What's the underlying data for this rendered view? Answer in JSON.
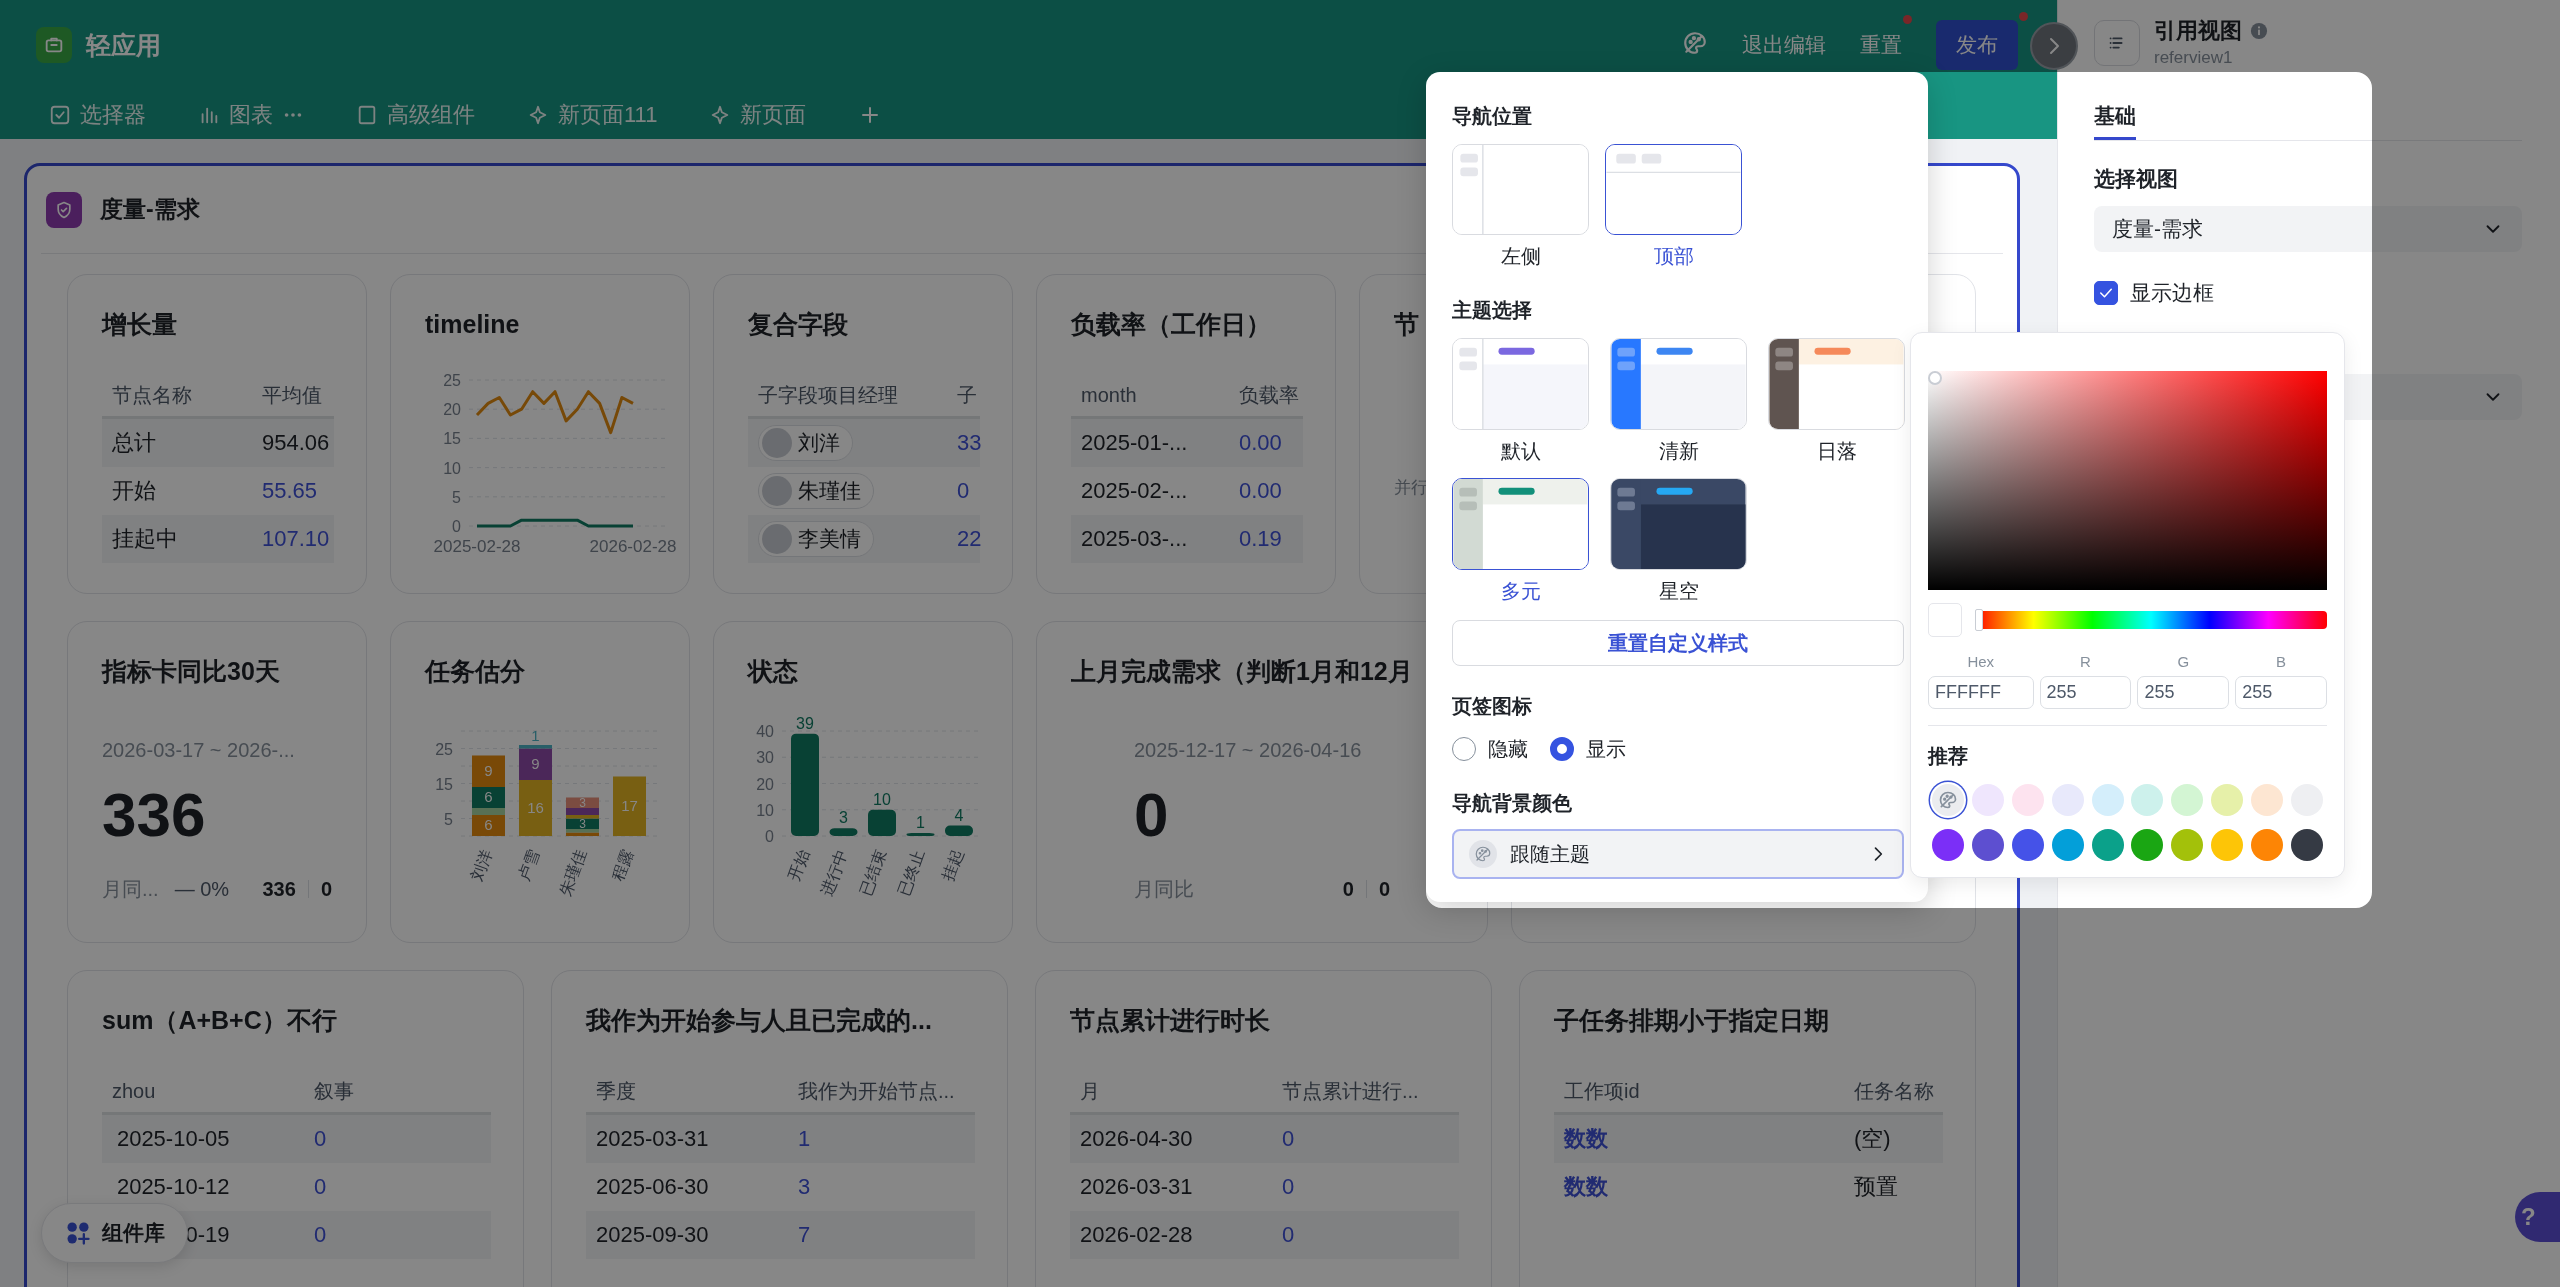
{
  "topbar": {
    "app_name": "轻应用",
    "tabs": [
      {
        "label": "选择器",
        "menu": false,
        "selected": false
      },
      {
        "label": "图表",
        "menu": true,
        "selected": false
      },
      {
        "label": "高级组件",
        "menu": false,
        "selected": false
      },
      {
        "label": "新页面111",
        "menu": false,
        "selected": false
      },
      {
        "label": "新页面",
        "menu": false,
        "selected": false
      }
    ],
    "actions": [
      {
        "label": "退出编辑",
        "kind": "text",
        "dot": false
      },
      {
        "label": "重置",
        "kind": "text",
        "dot": true
      },
      {
        "label": "发布",
        "kind": "primary",
        "dot": true
      }
    ]
  },
  "dashboard": {
    "title": "度量-需求",
    "top_row": [
      {
        "kind": "table",
        "title": "增长量",
        "columns": [
          "节点名称",
          "平均值"
        ],
        "rows": [
          [
            {
              "kind": "text",
              "text": "总计"
            },
            {
              "kind": "text",
              "text": "954.06"
            }
          ],
          [
            {
              "kind": "text",
              "text": "开始"
            },
            {
              "kind": "link",
              "text": "55.65"
            }
          ],
          [
            {
              "kind": "text",
              "text": "挂起中"
            },
            {
              "kind": "link",
              "text": "107.10"
            }
          ]
        ]
      },
      {
        "kind": "chart",
        "title": "timeline",
        "chart_data": {
          "type": "line",
          "grid": true,
          "categories": [
            "2025-02-28",
            null,
            null,
            null,
            null,
            null,
            null,
            null,
            null,
            null,
            null,
            null,
            null,
            null,
            "2026-02-28"
          ],
          "ylim": [
            0,
            25
          ],
          "yticks": [
            0,
            5,
            10,
            15,
            20,
            25
          ],
          "series": [
            {
              "color": "#774908",
              "values": [
                19,
                21,
                22,
                19,
                20,
                23,
                21,
                23,
                18,
                20,
                23,
                21,
                16,
                22,
                21
              ]
            },
            {
              "color": "#084134",
              "values": [
                0,
                0,
                0,
                0,
                1,
                1,
                1,
                1,
                1,
                1,
                0,
                0,
                0,
                0,
                0
              ]
            }
          ]
        }
      },
      {
        "kind": "table",
        "title": "复合字段",
        "columns": [
          "子字段项目经理",
          "子"
        ],
        "rows": [
          [
            {
              "kind": "person",
              "text": "刘洋"
            },
            {
              "kind": "link",
              "text": "33"
            }
          ],
          [
            {
              "kind": "person",
              "text": "朱瑾佳"
            },
            {
              "kind": "link",
              "text": "0"
            }
          ],
          [
            {
              "kind": "person",
              "text": "李美情"
            },
            {
              "kind": "link",
              "text": "22"
            }
          ]
        ]
      },
      {
        "kind": "table",
        "title": "负载率（工作日）",
        "columns": [
          "month",
          "负载率"
        ],
        "rows": [
          [
            {
              "kind": "text",
              "text": "2025-01-..."
            },
            {
              "kind": "link",
              "text": "0.00"
            }
          ],
          [
            {
              "kind": "text",
              "text": "2025-02-..."
            },
            {
              "kind": "link",
              "text": "0.00"
            }
          ],
          [
            {
              "kind": "text",
              "text": "2025-03-..."
            },
            {
              "kind": "link",
              "text": "0.19"
            }
          ]
        ]
      },
      {
        "kind": "note",
        "title": "节",
        "text": "并行"
      }
    ],
    "middle_row": [
      {
        "kind": "metric",
        "title": "指标卡同比30天",
        "date": "2026-03-17 ~ 2026-...",
        "value": "336",
        "compare_label": "月同...",
        "trend": "— 0%",
        "current": "336",
        "previous": "0"
      },
      {
        "kind": "chart",
        "title": "任务估分",
        "chart_data": {
          "type": "bar",
          "stacked": true,
          "grid": true,
          "categories": [
            "刘洋",
            "卢雪",
            "朱瑾佳",
            "程露"
          ],
          "ylim": [
            0,
            30
          ],
          "yticks": [
            5,
            15,
            25
          ],
          "series": [
            {
              "color": "#794907",
              "values": [
                6,
                null,
                1,
                null
              ],
              "value_labels": [
                "6",
                null,
                null,
                null
              ]
            },
            {
              "color": "#587055",
              "values": [
                2,
                null,
                1,
                null
              ],
              "value_labels": [
                null,
                null,
                null,
                null
              ]
            },
            {
              "color": "#084134",
              "values": [
                6,
                null,
                3,
                null
              ],
              "value_labels": [
                "6",
                null,
                "3",
                null
              ]
            },
            {
              "color": "#785f12",
              "values": [
                null,
                16,
                1,
                17
              ],
              "value_labels": [
                null,
                "16",
                null,
                "17"
              ]
            },
            {
              "color": "#794907",
              "values": [
                9,
                null,
                null,
                null
              ],
              "value_labels": [
                "9",
                null,
                null,
                null
              ]
            },
            {
              "color": "#4b2759",
              "values": [
                null,
                9,
                2,
                null
              ],
              "value_labels": [
                null,
                "9",
                null,
                null
              ]
            },
            {
              "color": "#7b4c41",
              "values": [
                null,
                null,
                3,
                null
              ],
              "value_labels": [
                null,
                null,
                "3",
                null
              ]
            },
            {
              "color": "#285f68",
              "values": [
                null,
                1,
                null,
                null
              ],
              "value_labels": [
                null,
                "1",
                null,
                null
              ]
            }
          ]
        }
      },
      {
        "kind": "chart",
        "title": "状态",
        "chart_data": {
          "type": "bar",
          "grid": true,
          "data_labels": true,
          "categories": [
            "开始",
            "进行中",
            "已结束",
            "已终止",
            "挂起"
          ],
          "ylim": [
            0,
            40
          ],
          "yticks": [
            0,
            10,
            20,
            30,
            40
          ],
          "series": [
            {
              "color": "#084134",
              "values": [
                39,
                3,
                10,
                1,
                4
              ]
            }
          ]
        }
      },
      {
        "kind": "metric",
        "title": "上月完成需求（判断1月和12月",
        "date": "2025-12-17 ~ 2026-04-16",
        "value": "0",
        "compare_label": "月同比",
        "current": "0",
        "previous": "0"
      },
      {
        "kind": "blank"
      }
    ],
    "bottom_row": [
      {
        "kind": "table",
        "title": "sum（A+B+C）不行",
        "columns": [
          "zhou",
          "叙事"
        ],
        "rows": [
          [
            {
              "kind": "date",
              "text": "2025-10-05"
            },
            {
              "kind": "link",
              "text": "0"
            }
          ],
          [
            {
              "kind": "date",
              "text": "2025-10-12"
            },
            {
              "kind": "link",
              "text": "0"
            }
          ],
          [
            {
              "kind": "date",
              "text": "0-19"
            },
            {
              "kind": "link",
              "text": "0"
            }
          ]
        ]
      },
      {
        "kind": "table",
        "title": "我作为开始参与人且已完成的...",
        "columns": [
          "季度",
          "我作为开始节点..."
        ],
        "rows": [
          [
            {
              "kind": "text",
              "text": "2025-03-31"
            },
            {
              "kind": "link",
              "text": "1"
            }
          ],
          [
            {
              "kind": "text",
              "text": "2025-06-30"
            },
            {
              "kind": "link",
              "text": "3"
            }
          ],
          [
            {
              "kind": "text",
              "text": "2025-09-30"
            },
            {
              "kind": "link",
              "text": "7"
            }
          ]
        ]
      },
      {
        "kind": "table",
        "title": "节点累计进行时长",
        "columns": [
          "月",
          "节点累计进行..."
        ],
        "rows": [
          [
            {
              "kind": "text",
              "text": "2026-04-30"
            },
            {
              "kind": "link",
              "text": "0"
            }
          ],
          [
            {
              "kind": "text",
              "text": "2026-03-31"
            },
            {
              "kind": "link",
              "text": "0"
            }
          ],
          [
            {
              "kind": "text",
              "text": "2026-02-28"
            },
            {
              "kind": "link",
              "text": "0"
            }
          ]
        ]
      },
      {
        "kind": "table",
        "title": "子任务排期小于指定日期",
        "columns": [
          "工作项id",
          "任务名称"
        ],
        "rows": [
          [
            {
              "kind": "strong_link",
              "text": "数数"
            },
            {
              "kind": "text",
              "text": "(空)"
            }
          ],
          [
            {
              "kind": "strong_link",
              "text": "数数"
            },
            {
              "kind": "text",
              "text": "预置"
            }
          ]
        ]
      }
    ]
  },
  "component_library_button": {
    "label": "组件库"
  },
  "right_panel": {
    "title": "引用视图",
    "subtitle": "referview1",
    "tabs": [
      {
        "label": "基础",
        "selected": true
      }
    ],
    "view_label": "选择视图",
    "view_value": "度量-需求",
    "show_border": {
      "label": "显示边框",
      "checked": true
    }
  },
  "nav_settings": {
    "position": {
      "title": "导航位置",
      "options": [
        {
          "kind": "left",
          "label": "左侧",
          "selected": false
        },
        {
          "kind": "top",
          "label": "顶部",
          "selected": true
        }
      ]
    },
    "theme": {
      "title": "主题选择",
      "options": [
        {
          "label": "默认",
          "selected": false
        },
        {
          "label": "清新",
          "selected": false
        },
        {
          "label": "日落",
          "selected": false
        },
        {
          "label": "多元",
          "selected": true
        },
        {
          "label": "星空",
          "selected": false
        }
      ]
    },
    "reset_button": "重置自定义样式",
    "tab_icon": {
      "title": "页签图标",
      "options": [
        {
          "label": "隐藏",
          "selected": false
        },
        {
          "label": "显示",
          "selected": true
        }
      ]
    },
    "nav_color": {
      "title": "导航背景颜色",
      "value": "跟随主题"
    }
  },
  "color_picker": {
    "hue_slider": {
      "level": 0
    },
    "fields": [
      {
        "label": "Hex",
        "value": "FFFFFF"
      },
      {
        "label": "R",
        "value": "255"
      },
      {
        "label": "G",
        "value": "255"
      },
      {
        "label": "B",
        "value": "255"
      }
    ],
    "recommended_title": "推荐",
    "swatches": [
      {
        "kind": "theme",
        "selected": true
      },
      {
        "kind": "color",
        "color": "#efe6fd",
        "selected": false
      },
      {
        "kind": "color",
        "color": "#fde3ef",
        "selected": false
      },
      {
        "kind": "color",
        "color": "#e8e9fb",
        "selected": false
      },
      {
        "kind": "color",
        "color": "#d4eefb",
        "selected": false
      },
      {
        "kind": "color",
        "color": "#cdf1ec",
        "selected": false
      },
      {
        "kind": "color",
        "color": "#d3f5d3",
        "selected": false
      },
      {
        "kind": "color",
        "color": "#e6f0a9",
        "selected": false
      },
      {
        "kind": "color",
        "color": "#fde6d2",
        "selected": false
      },
      {
        "kind": "color",
        "color": "#eeeff2",
        "selected": false
      },
      {
        "kind": "color",
        "color": "#7b2ff7",
        "selected": false
      },
      {
        "kind": "color",
        "color": "#5d4fd0",
        "selected": false
      },
      {
        "kind": "color",
        "color": "#4552e8",
        "selected": false
      },
      {
        "kind": "color",
        "color": "#039fd9",
        "selected": false
      },
      {
        "kind": "color",
        "color": "#0ba18a",
        "selected": false
      },
      {
        "kind": "color",
        "color": "#1aa613",
        "selected": false
      },
      {
        "kind": "color",
        "color": "#a3c10a",
        "selected": false
      },
      {
        "kind": "color",
        "color": "#fdc507",
        "selected": false
      },
      {
        "kind": "color",
        "color": "#fd8505",
        "selected": false
      },
      {
        "kind": "color",
        "color": "#353a44",
        "selected": false
      }
    ]
  },
  "help_button": {
    "label": "?"
  }
}
